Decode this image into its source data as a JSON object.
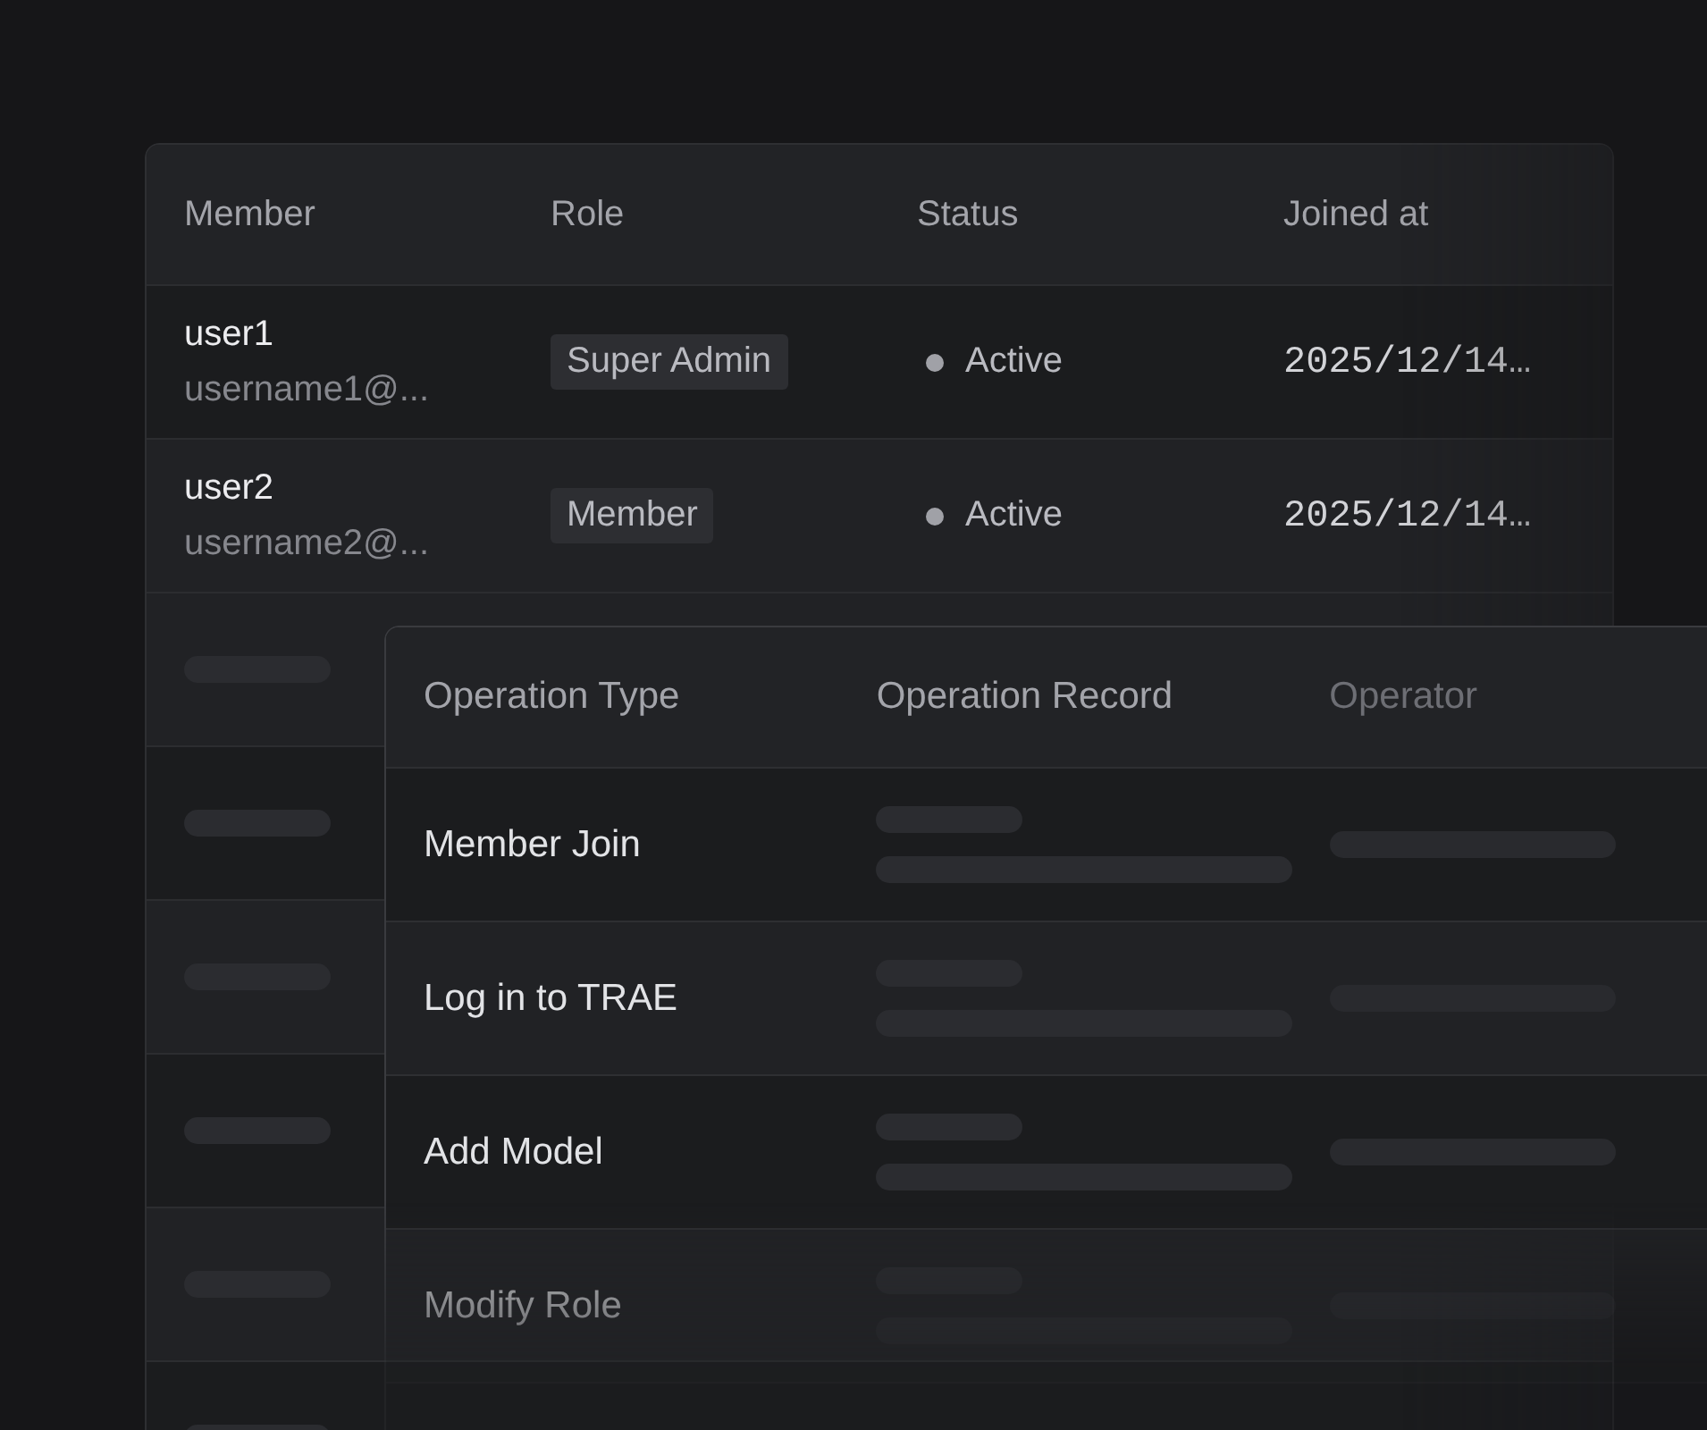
{
  "members_table": {
    "columns": [
      "Member",
      "Role",
      "Status",
      "Joined at"
    ],
    "rows": [
      {
        "name": "user1",
        "email": "username1@...",
        "role": "Super Admin",
        "status": "Active",
        "joined": "2025/12/14…"
      },
      {
        "name": "user2",
        "email": "username2@...",
        "role": "Member",
        "status": "Active",
        "joined": "2025/12/14…"
      }
    ]
  },
  "operations_table": {
    "columns": [
      "Operation Type",
      "Operation Record",
      "Operator"
    ],
    "rows": [
      {
        "type": "Member Join"
      },
      {
        "type": "Log in to TRAE"
      },
      {
        "type": "Add Model"
      },
      {
        "type": "Modify Role"
      }
    ]
  }
}
